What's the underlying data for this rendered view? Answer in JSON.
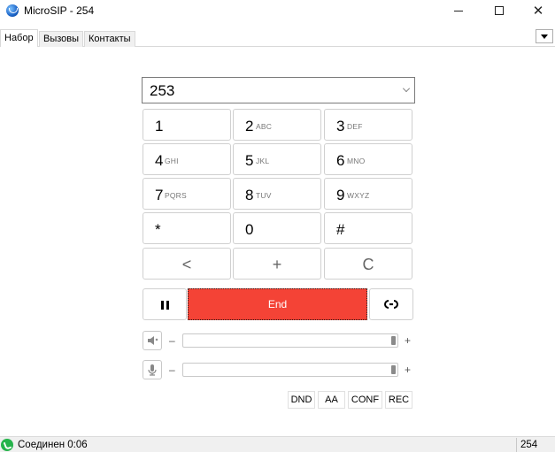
{
  "window": {
    "title": "MicroSIP - 254"
  },
  "tabs": [
    {
      "label": "Набор"
    },
    {
      "label": "Вызовы"
    },
    {
      "label": "Контакты"
    }
  ],
  "dialer": {
    "number": "253",
    "keys": [
      {
        "digit": "1",
        "letters": ""
      },
      {
        "digit": "2",
        "letters": "ABC"
      },
      {
        "digit": "3",
        "letters": "DEF"
      },
      {
        "digit": "4",
        "letters": "GHI"
      },
      {
        "digit": "5",
        "letters": "JKL"
      },
      {
        "digit": "6",
        "letters": "MNO"
      },
      {
        "digit": "7",
        "letters": "PQRS"
      },
      {
        "digit": "8",
        "letters": "TUV"
      },
      {
        "digit": "9",
        "letters": "WXYZ"
      },
      {
        "digit": "*",
        "letters": ""
      },
      {
        "digit": "0",
        "letters": ""
      },
      {
        "digit": "#",
        "letters": ""
      }
    ],
    "actions": {
      "backspace": "<",
      "plus": "+",
      "clear": "C"
    },
    "end_label": "End",
    "transfer_label": "⭠⭢"
  },
  "audio": {
    "minus": "–",
    "plus": "+",
    "speaker_level_percent": 100,
    "mic_level_percent": 100
  },
  "modes": {
    "dnd": "DND",
    "aa": "AA",
    "conf": "CONF",
    "rec": "REC"
  },
  "status": {
    "text": "Соединен 0:06",
    "account": "254"
  },
  "colors": {
    "end_button": "#f44336",
    "status_icon": "#25b34b"
  }
}
